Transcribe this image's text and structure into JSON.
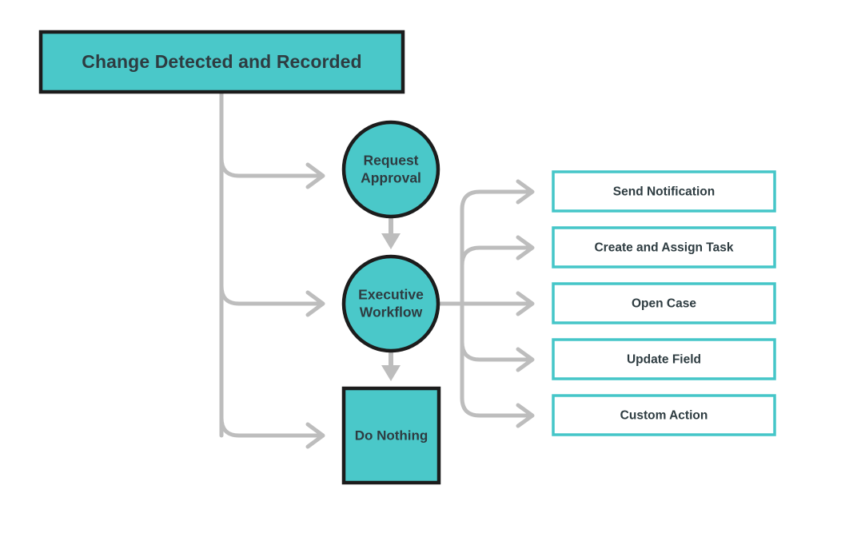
{
  "diagram": {
    "title_node": {
      "label": "Change Detected and Recorded",
      "shape": "rectangle",
      "fill": "#4ac8c9",
      "border": "#1c1c1c",
      "text_color": "#2e3c41"
    },
    "decision_nodes": [
      {
        "id": "request-approval",
        "label_line1": "Request",
        "label_line2": "Approval",
        "shape": "circle",
        "fill": "#4ac8c9",
        "border": "#1c1c1c"
      },
      {
        "id": "executive-workflow",
        "label_line1": "Executive",
        "label_line2": "Workflow",
        "shape": "circle",
        "fill": "#4ac8c9",
        "border": "#1c1c1c"
      },
      {
        "id": "do-nothing",
        "label_line1": "Do Nothing",
        "label_line2": "",
        "shape": "square",
        "fill": "#4ac8c9",
        "border": "#1c1c1c"
      }
    ],
    "action_nodes": [
      {
        "id": "send-notification",
        "label": "Send Notification",
        "fill": "#ffffff",
        "border": "#45c6c8"
      },
      {
        "id": "create-assign-task",
        "label": "Create and Assign Task",
        "fill": "#ffffff",
        "border": "#45c6c8"
      },
      {
        "id": "open-case",
        "label": "Open Case",
        "fill": "#ffffff",
        "border": "#45c6c8"
      },
      {
        "id": "update-field",
        "label": "Update Field",
        "fill": "#ffffff",
        "border": "#45c6c8"
      },
      {
        "id": "custom-action",
        "label": "Custom Action",
        "fill": "#ffffff",
        "border": "#45c6c8"
      }
    ],
    "connector_color": "#bdbdbd",
    "arrow_fill_color": "#bdbdbd",
    "background": "#ffffff"
  }
}
